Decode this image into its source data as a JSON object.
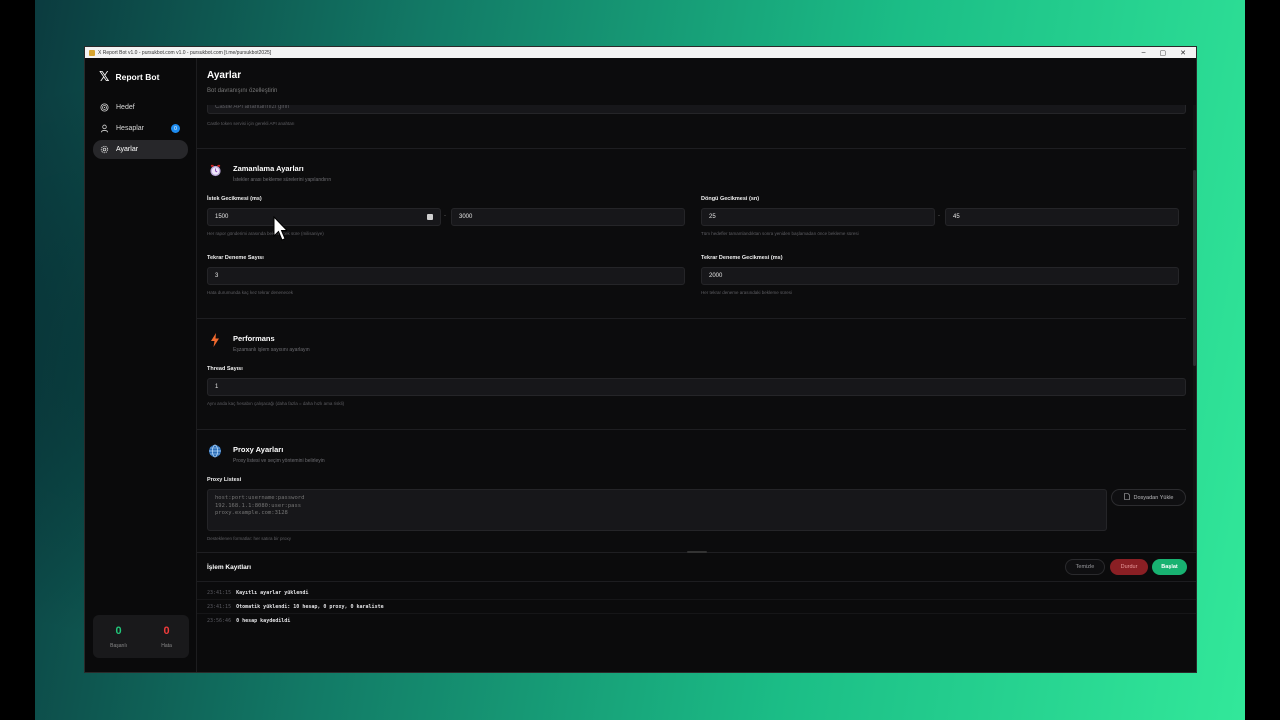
{
  "window": {
    "title": "X Report Bot v1.0 - pursukbot.com v1.0 - pursukbot.com [t.me/pursukbot2025]",
    "controls": [
      "–",
      "▢",
      "✕"
    ]
  },
  "sidebar": {
    "brand": "Report Bot",
    "items": [
      {
        "label": "Hedef",
        "icon": "target-icon"
      },
      {
        "label": "Hesaplar",
        "icon": "user-icon",
        "badge": "0"
      },
      {
        "label": "Ayarlar",
        "icon": "gear-icon",
        "active": true
      }
    ],
    "stats": {
      "success_value": "0",
      "success_label": "Başarılı",
      "error_value": "0",
      "error_label": "Hata"
    }
  },
  "header": {
    "title": "Ayarlar",
    "subtitle": "Bot davranışını özelleştirin"
  },
  "api": {
    "placeholder": "Castle API anahtarınızı girin",
    "help": "Castle token servisi için gerekli API anahtarı"
  },
  "timing": {
    "title": "Zamanlama Ayarları",
    "subtitle": "İstekler arası bekleme sürelerini yapılandırın",
    "request_delay": {
      "label": "İstek Gecikmesi (ms)",
      "min": "1500",
      "max": "3000",
      "separator": "-",
      "help": "Her rapor gönderimi arasında beklenecek süre (milisaniye)"
    },
    "loop_delay": {
      "label": "Döngü Gecikmesi (sn)",
      "min": "25",
      "max": "45",
      "separator": "-",
      "help": "Tüm hedefler tamamlandıktan sonra yeniden başlamadan önce bekleme süresi"
    },
    "retry_count": {
      "label": "Tekrar Deneme Sayısı",
      "value": "3",
      "help": "Hata durumunda kaç kez tekrar denenecek"
    },
    "retry_delay": {
      "label": "Tekrar Deneme Gecikmesi (ms)",
      "value": "2000",
      "help": "Her tekrar deneme arasındaki bekleme süresi"
    }
  },
  "performance": {
    "title": "Performans",
    "subtitle": "Eşzamanlı işlem sayısını ayarlayın",
    "thread_label": "Thread Sayısı",
    "thread_value": "1",
    "thread_help": "Aynı anda kaç hesabın çalışacağı (daha fazla = daha hızlı ama riskli)"
  },
  "proxy": {
    "title": "Proxy Ayarları",
    "subtitle": "Proxy listesi ve seçim yöntemini belirleyin",
    "list_label": "Proxy Listesi",
    "placeholder": "host:port:username:password\n192.168.1.1:8080:user:pass\nproxy.example.com:3128",
    "upload_label": "Dosyadan Yükle",
    "help": "Desteklenen formatlar: her satıra bir proxy"
  },
  "logs": {
    "title": "İşlem Kayıtları",
    "clear_label": "Temizle",
    "stop_label": "Durdur",
    "start_label": "Başlat",
    "entries": [
      {
        "time": "23:41:15",
        "message": "Kayıtlı ayarlar yüklendi"
      },
      {
        "time": "23:41:15",
        "message": "Otomatik yüklendi: 10 hesap, 0 proxy, 0 karaliste"
      },
      {
        "time": "23:56:46",
        "message": "0 hesap kaydedildi"
      }
    ]
  },
  "colors": {
    "accent_green": "#18b271",
    "stop_red": "#8a1f24",
    "badge_blue": "#1d8cf0"
  }
}
